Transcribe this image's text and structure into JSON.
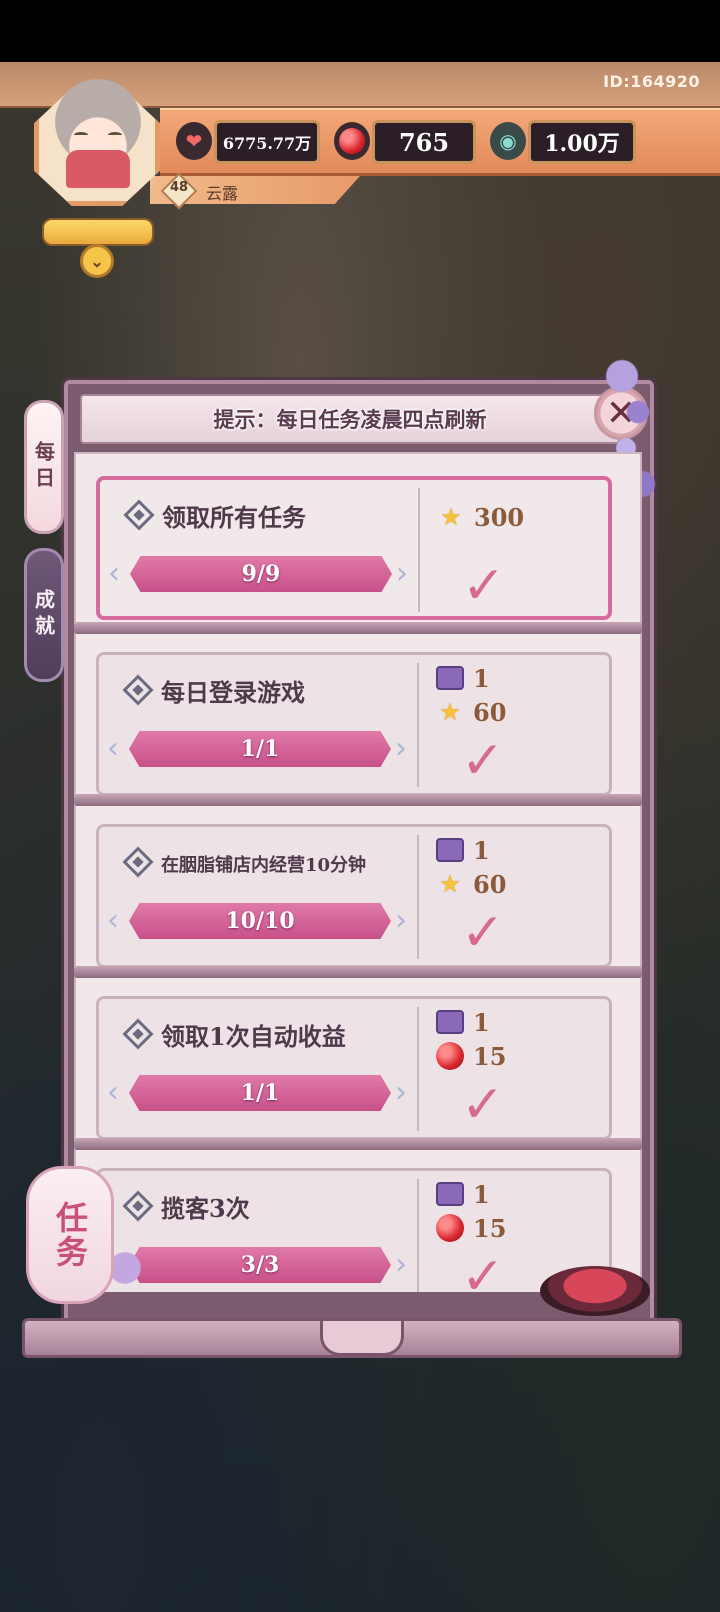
{
  "hud": {
    "player_id": "ID:164920",
    "level": "48",
    "player_name": "云露",
    "resources": [
      {
        "icon": "heart-coin-icon",
        "value": "6775.77万"
      },
      {
        "icon": "ruby-icon",
        "value": "765"
      },
      {
        "icon": "jade-icon",
        "value": "1.00万"
      }
    ]
  },
  "panel": {
    "header_hint": "提示：每日任务凌晨四点刷新",
    "tabs": [
      {
        "label": "每日",
        "active": true
      },
      {
        "label": "成就",
        "active": false
      }
    ],
    "lantern_label": "任务"
  },
  "tasks": [
    {
      "title": "领取所有任务",
      "progress": "9/9",
      "rewards": [
        {
          "icon": "star-icon",
          "value": "300"
        }
      ],
      "completed": true
    },
    {
      "title": "每日登录游戏",
      "progress": "1/1",
      "rewards": [
        {
          "icon": "chest-icon",
          "value": "1"
        },
        {
          "icon": "star-icon",
          "value": "60"
        }
      ],
      "completed": true
    },
    {
      "title": "在胭脂铺店内经营10分钟",
      "progress": "10/10",
      "rewards": [
        {
          "icon": "chest-icon",
          "value": "1"
        },
        {
          "icon": "star-icon",
          "value": "60"
        }
      ],
      "completed": true
    },
    {
      "title": "领取1次自动收益",
      "progress": "1/1",
      "rewards": [
        {
          "icon": "chest-icon",
          "value": "1"
        },
        {
          "icon": "ruby-icon",
          "value": "15"
        }
      ],
      "completed": true
    },
    {
      "title": "揽客3次",
      "progress": "3/3",
      "rewards": [
        {
          "icon": "chest-icon",
          "value": "1"
        },
        {
          "icon": "ruby-icon",
          "value": "15"
        }
      ],
      "completed": true
    }
  ],
  "colors": {
    "accent_pink": "#d86a9e",
    "progress_fill": "#c8508a",
    "reward_text": "#8a5a3a"
  }
}
